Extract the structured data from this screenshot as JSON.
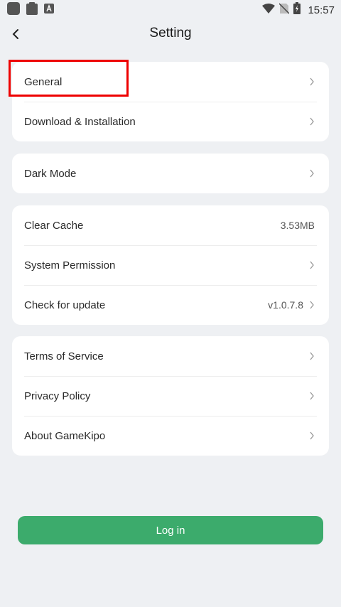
{
  "status_bar": {
    "time": "15:57",
    "icons": [
      "app-icon",
      "clipboard-icon",
      "a-badge-icon",
      "wifi-icon",
      "no-sim-icon",
      "battery-charging-icon"
    ]
  },
  "header": {
    "title": "Setting",
    "back_icon": "chevron-left-icon"
  },
  "groups": [
    {
      "items": [
        {
          "label": "General"
        },
        {
          "label": "Download & Installation"
        }
      ]
    },
    {
      "items": [
        {
          "label": "Dark Mode"
        }
      ]
    },
    {
      "items": [
        {
          "label": "Clear Cache",
          "value": "3.53MB"
        },
        {
          "label": "System Permission"
        },
        {
          "label": "Check for update",
          "value": "v1.0.7.8"
        }
      ]
    },
    {
      "items": [
        {
          "label": "Terms of Service"
        },
        {
          "label": "Privacy Policy"
        },
        {
          "label": "About GameKipo"
        }
      ]
    }
  ],
  "login_button": {
    "label": "Log in"
  },
  "colors": {
    "background": "#eef0f3",
    "card": "#ffffff",
    "accent_green": "#3cab6c",
    "highlight_red": "#ee0000"
  }
}
